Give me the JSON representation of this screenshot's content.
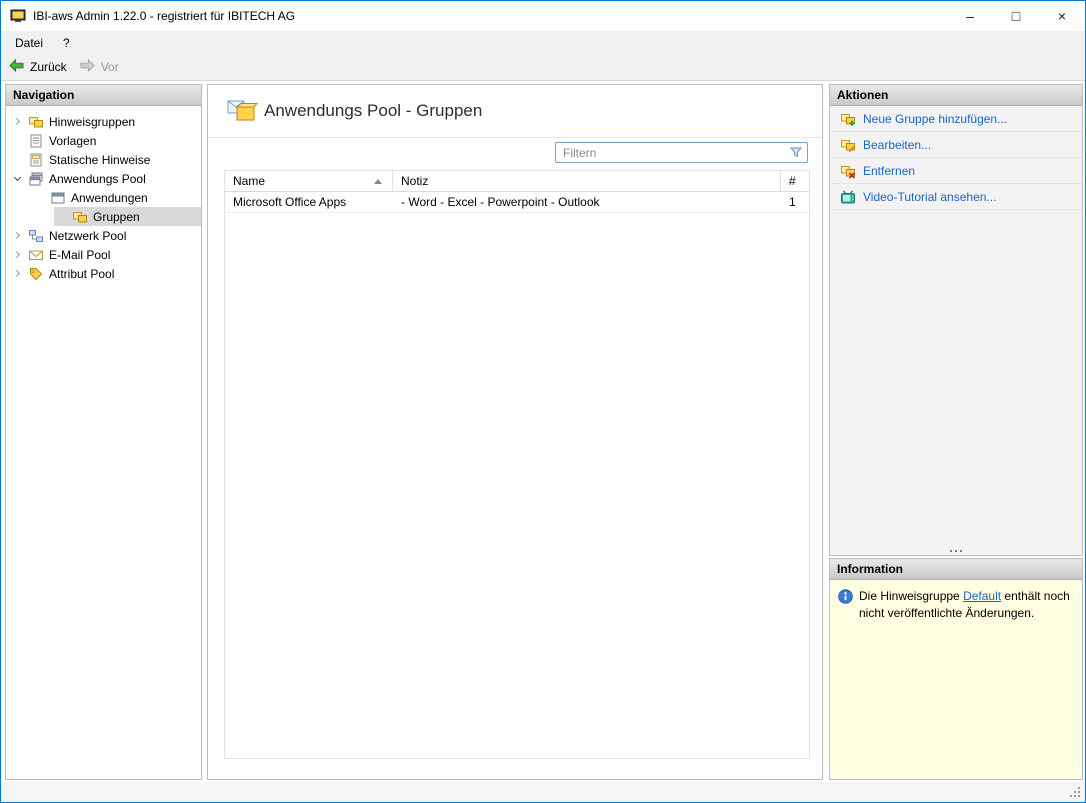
{
  "window": {
    "title": "IBI-aws Admin 1.22.0 - registriert für IBITECH AG",
    "controls": {
      "minimize": "–",
      "maximize": "□",
      "close": "×"
    }
  },
  "menubar": {
    "items": [
      {
        "label": "Datei"
      },
      {
        "label": "?"
      }
    ]
  },
  "toolbar": {
    "back_label": "Zurück",
    "forward_label": "Vor"
  },
  "navigation": {
    "header": "Navigation",
    "items": [
      {
        "label": "Hinweisgruppen",
        "icon": "hint-groups-icon",
        "expander": "collapsed",
        "level": 0,
        "selected": false
      },
      {
        "label": "Vorlagen",
        "icon": "templates-icon",
        "expander": "none",
        "level": 0,
        "selected": false
      },
      {
        "label": "Statische Hinweise",
        "icon": "static-hints-icon",
        "expander": "none",
        "level": 0,
        "selected": false
      },
      {
        "label": "Anwendungs Pool",
        "icon": "application-pool-icon",
        "expander": "expanded",
        "level": 0,
        "selected": false
      },
      {
        "label": "Anwendungen",
        "icon": "applications-icon",
        "expander": "none",
        "level": 1,
        "selected": false
      },
      {
        "label": "Gruppen",
        "icon": "groups-icon",
        "expander": "none",
        "level": 2,
        "selected": true
      },
      {
        "label": "Netzwerk Pool",
        "icon": "network-pool-icon",
        "expander": "collapsed",
        "level": 0,
        "selected": false
      },
      {
        "label": "E-Mail Pool",
        "icon": "email-pool-icon",
        "expander": "collapsed",
        "level": 0,
        "selected": false
      },
      {
        "label": "Attribut Pool",
        "icon": "attribute-pool-icon",
        "expander": "collapsed",
        "level": 0,
        "selected": false
      }
    ]
  },
  "main": {
    "title": "Anwendungs Pool - Gruppen",
    "filter": {
      "placeholder": "Filtern"
    },
    "table": {
      "columns": [
        "Name",
        "Notiz",
        "#"
      ],
      "sort_column": "Name",
      "sort_direction": "ascending",
      "rows": [
        {
          "name": "Microsoft Office Apps",
          "notiz": "- Word - Excel - Powerpoint - Outlook",
          "count": "1"
        }
      ]
    }
  },
  "actions": {
    "header": "Aktionen",
    "items": [
      {
        "label": "Neue Gruppe hinzufügen...",
        "icon": "add-group-icon"
      },
      {
        "label": "Bearbeiten...",
        "icon": "edit-group-icon"
      },
      {
        "label": "Entfernen",
        "icon": "remove-group-icon"
      },
      {
        "label": "Video-Tutorial ansehen...",
        "icon": "video-tutorial-icon"
      }
    ]
  },
  "information": {
    "header": "Information",
    "text_before": "Die Hinweisgruppe ",
    "link_text": "Default",
    "text_after": " enthält noch nicht veröffentlichte Änderungen."
  },
  "colors": {
    "window_border": "#0078d7",
    "link_blue": "#1b64c0",
    "info_background": "#ffffe1",
    "panel_header_gradient_top": "#eaeaea",
    "panel_header_gradient_bottom": "#c9c9c9",
    "selected_item_background": "#d9d9d9",
    "back_arrow_green": "#4caf3f"
  }
}
